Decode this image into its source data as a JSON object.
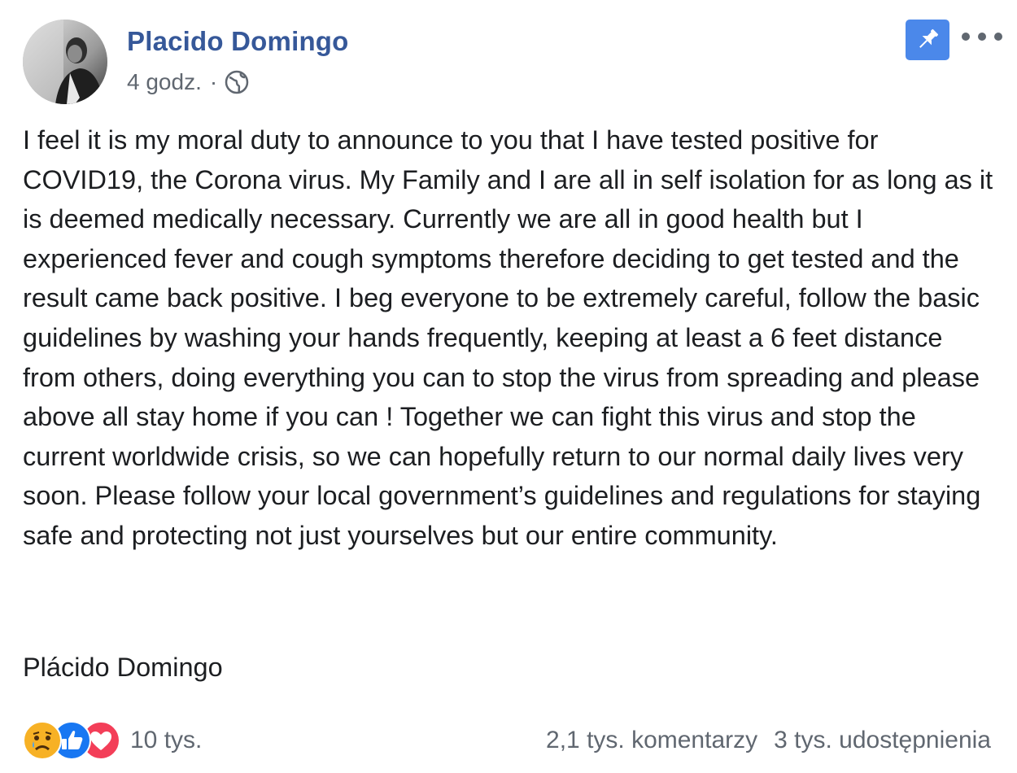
{
  "post": {
    "author": "Placido Domingo",
    "time": "4 godz.",
    "separator": "·",
    "audience_icon": "globe-icon",
    "pin_icon": "pin-icon",
    "more_icon": "more-options-icon",
    "text": "I feel it is my moral duty to announce to you that I have tested positive for COVID19, the Corona virus. My Family and I are all in self isolation for as long as it is deemed medically necessary. Currently we are all in good health but I experienced fever and cough symptoms therefore deciding to get tested and the result came back positive. I beg everyone to be extremely careful, follow the basic guidelines by washing your hands frequently, keeping at least a 6 feet distance from others, doing everything you can to stop the virus from spreading and please above all stay home if you can ! Together we can fight this virus and stop the current worldwide crisis, so we can hopefully return to our normal daily lives very soon. Please follow your local government’s guidelines and regulations for staying safe and protecting not just yourselves but our entire community.",
    "signature": "Plácido Domingo"
  },
  "footer": {
    "reactions": [
      "sad-reaction-icon",
      "like-reaction-icon",
      "love-reaction-icon"
    ],
    "reaction_count": "10 tys.",
    "comments": "2,1 tys. komentarzy",
    "shares": "3 tys. udostępnienia"
  },
  "colors": {
    "author_link": "#365899",
    "meta_text": "#606770",
    "pin_button": "#4b88ea",
    "like_blue": "#1877f2",
    "love_red": "#f33e58",
    "sad_yellow": "#f7b125"
  }
}
